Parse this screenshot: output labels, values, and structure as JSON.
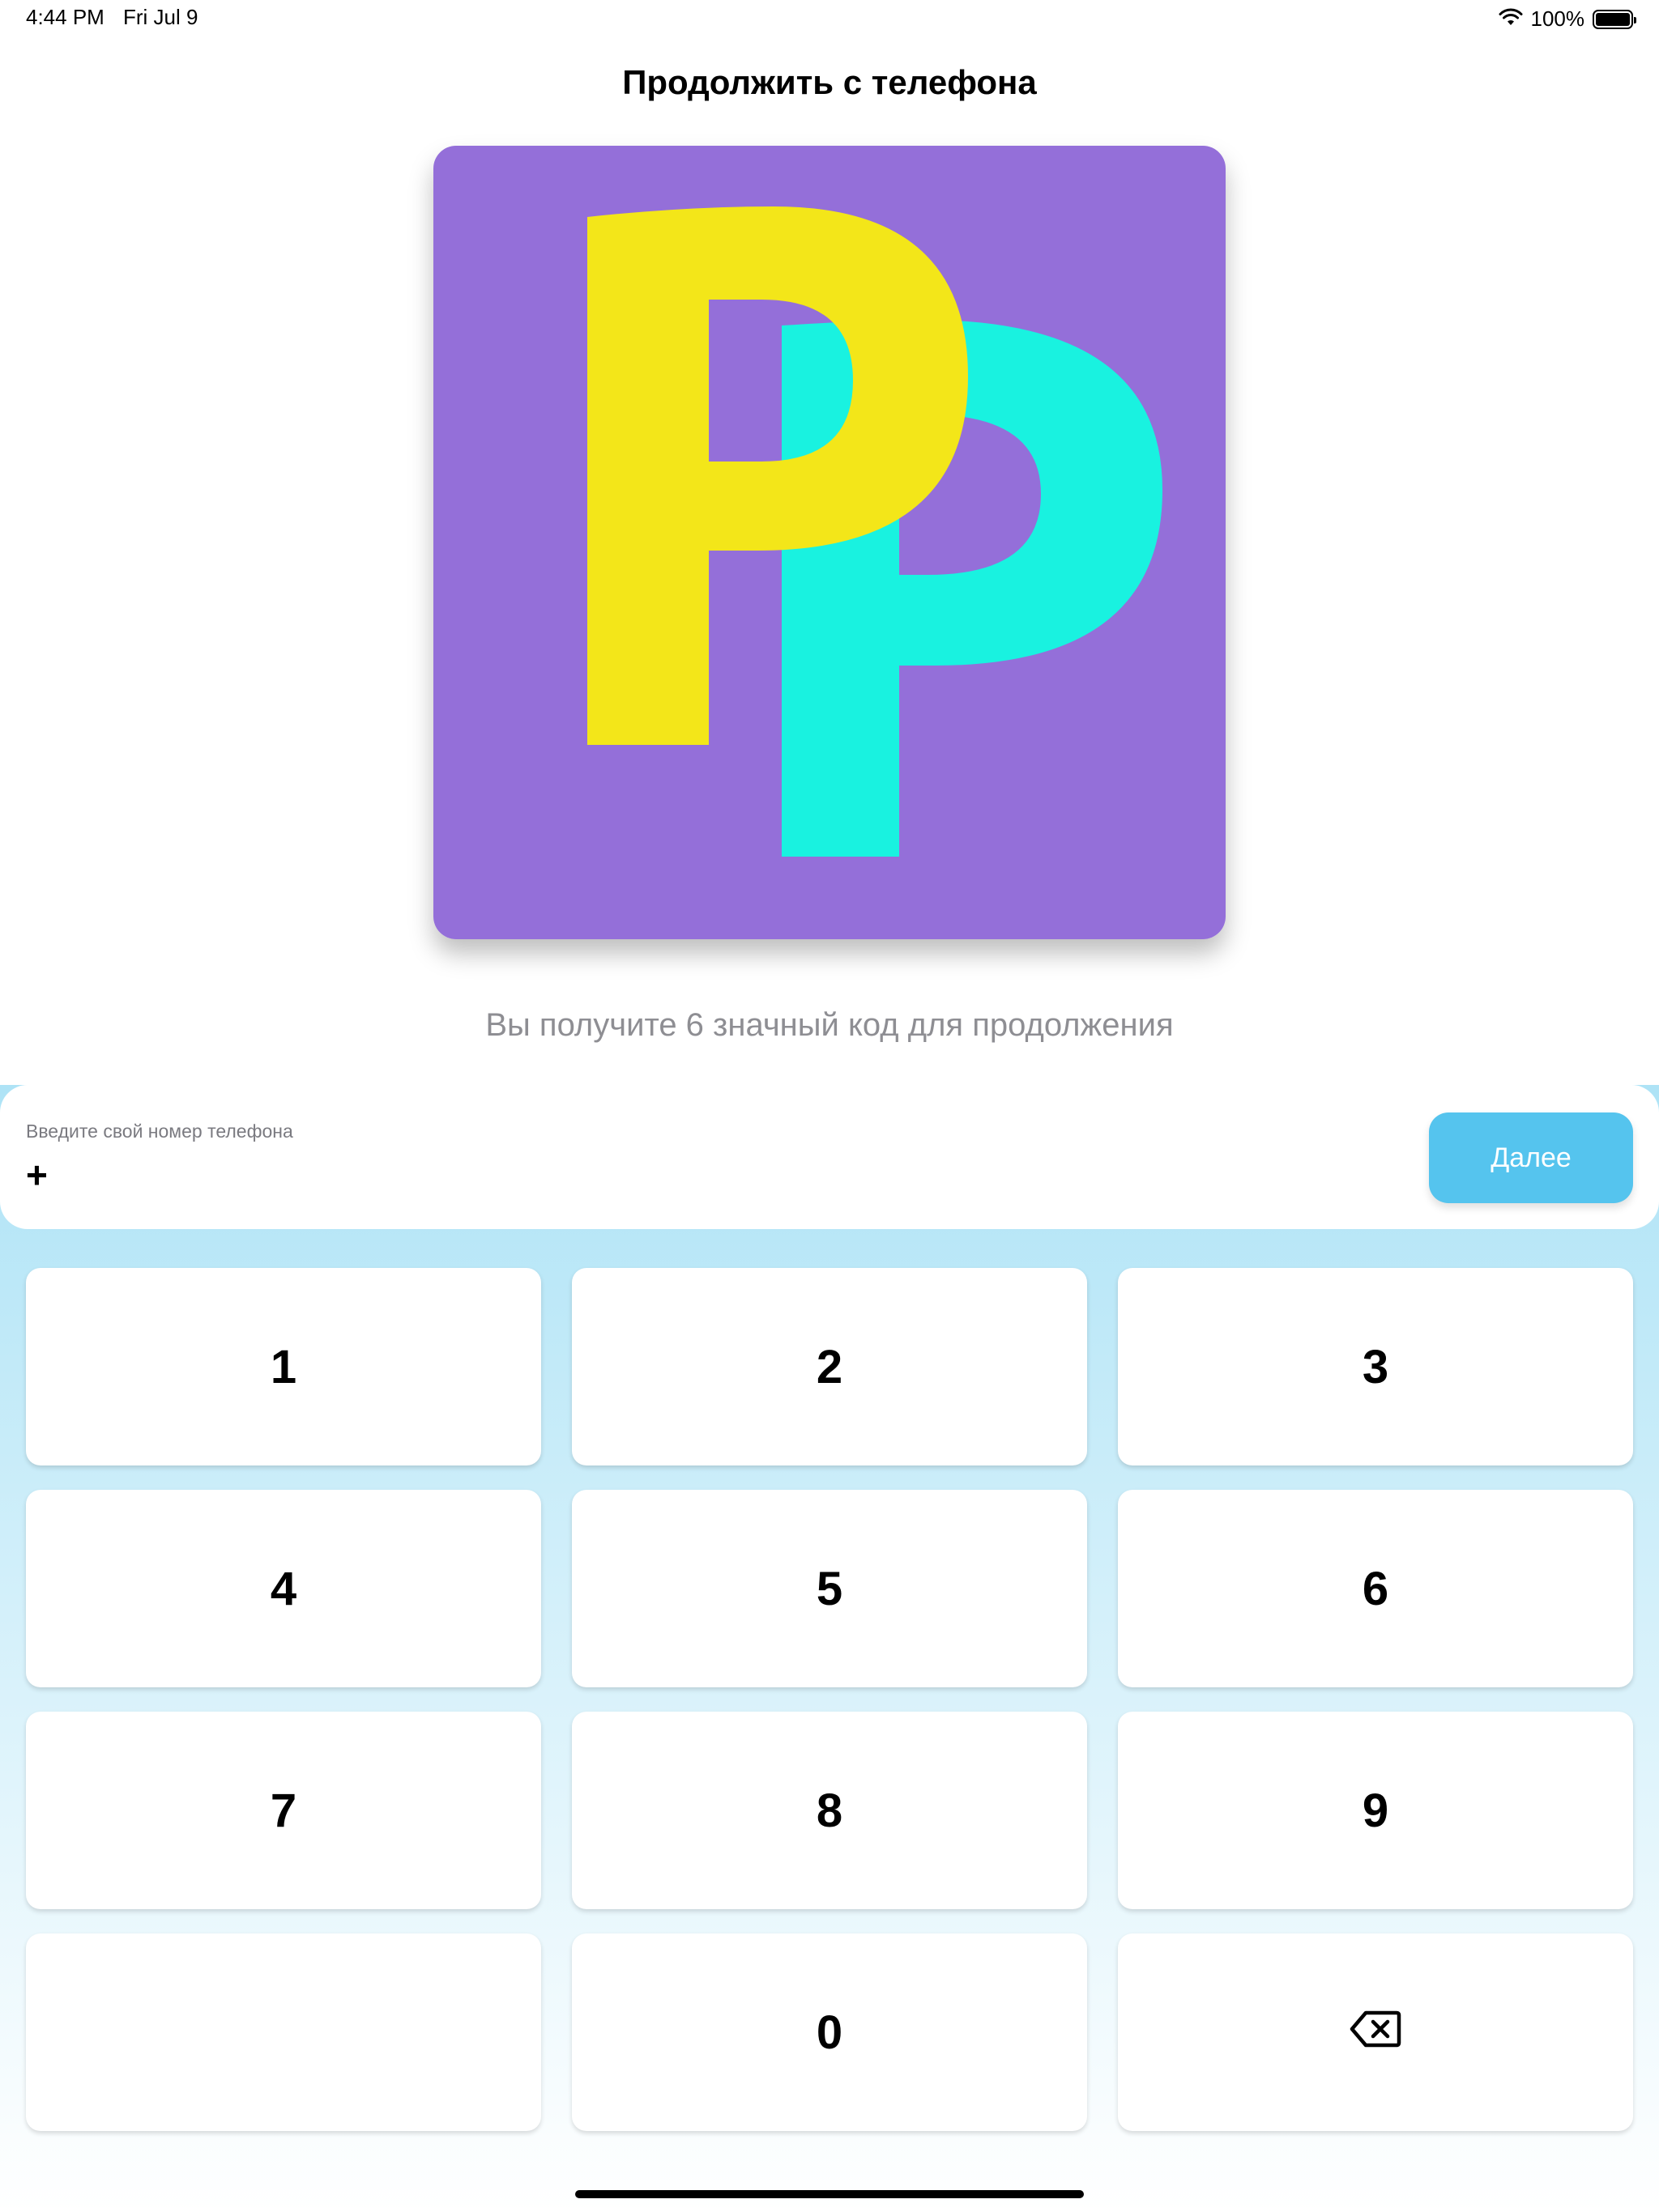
{
  "status_bar": {
    "time": "4:44 PM",
    "date": "Fri Jul 9",
    "battery": "100%",
    "wifi_icon": "wifi-icon",
    "battery_icon": "battery-icon"
  },
  "header": {
    "title": "Продолжить с телефона"
  },
  "logo": {
    "background_color": "#946fd9",
    "front_letter_color": "#f3e619",
    "back_letter_color": "#19f2e0"
  },
  "subtitle": "Вы получите 6 значный код для продолжения",
  "phone_entry": {
    "label": "Введите свой номер телефона",
    "value": "+",
    "next_label": "Далее",
    "next_color": "#55c4ee"
  },
  "keypad": {
    "keys": [
      "1",
      "2",
      "3",
      "4",
      "5",
      "6",
      "7",
      "8",
      "9",
      "",
      "0"
    ],
    "delete_icon": "backspace-icon"
  }
}
